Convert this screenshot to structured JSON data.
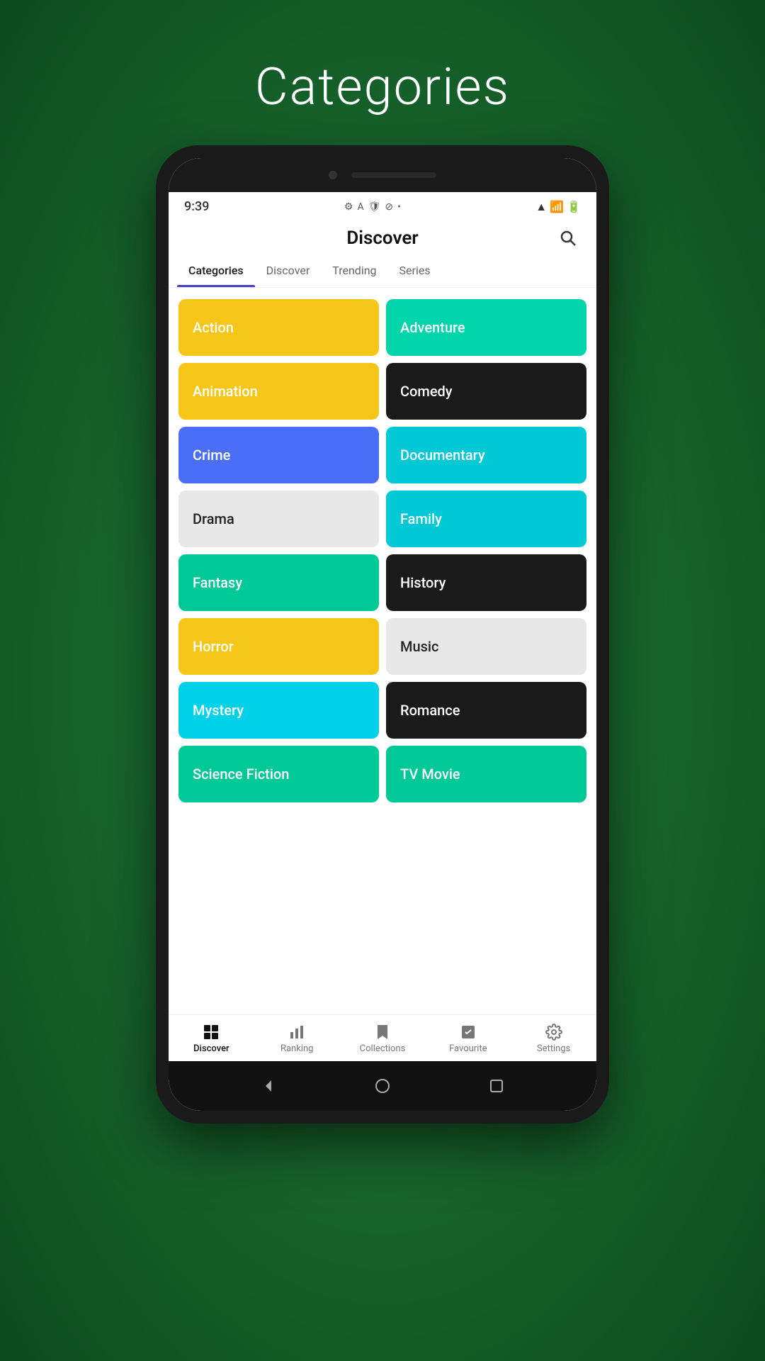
{
  "page": {
    "title": "Categories",
    "background_color": "#1a6b30"
  },
  "status_bar": {
    "time": "9:39",
    "dot": "•"
  },
  "app_header": {
    "title": "Discover"
  },
  "tabs": [
    {
      "label": "Categories",
      "active": true
    },
    {
      "label": "Discover",
      "active": false
    },
    {
      "label": "Trending",
      "active": false
    },
    {
      "label": "Series",
      "active": false
    }
  ],
  "categories": [
    {
      "label": "Action",
      "bg": "bg-yellow",
      "text": "light-text"
    },
    {
      "label": "Adventure",
      "bg": "bg-green",
      "text": "light-text"
    },
    {
      "label": "Animation",
      "bg": "bg-yellow",
      "text": "light-text"
    },
    {
      "label": "Comedy",
      "bg": "bg-dark",
      "text": "light-text"
    },
    {
      "label": "Crime",
      "bg": "bg-blue",
      "text": "light-text"
    },
    {
      "label": "Documentary",
      "bg": "bg-cyan",
      "text": "light-text"
    },
    {
      "label": "Drama",
      "bg": "bg-light",
      "text": "dark-text"
    },
    {
      "label": "Family",
      "bg": "bg-cyan",
      "text": "light-text"
    },
    {
      "label": "Fantasy",
      "bg": "bg-teal",
      "text": "light-text"
    },
    {
      "label": "History",
      "bg": "bg-dark",
      "text": "light-text"
    },
    {
      "label": "Horror",
      "bg": "bg-yellow",
      "text": "light-text"
    },
    {
      "label": "Music",
      "bg": "bg-light",
      "text": "dark-text"
    },
    {
      "label": "Mystery",
      "bg": "bg-cyan2",
      "text": "light-text"
    },
    {
      "label": "Romance",
      "bg": "bg-dark",
      "text": "light-text"
    },
    {
      "label": "Science Fiction",
      "bg": "bg-teal",
      "text": "light-text"
    },
    {
      "label": "TV Movie",
      "bg": "bg-teal",
      "text": "light-text"
    }
  ],
  "bottom_nav": [
    {
      "label": "Discover",
      "active": true,
      "icon": "🎬"
    },
    {
      "label": "Ranking",
      "active": false,
      "icon": "📊"
    },
    {
      "label": "Collections",
      "active": false,
      "icon": "🎞"
    },
    {
      "label": "Favourite",
      "active": false,
      "icon": "🔖"
    },
    {
      "label": "Settings",
      "active": false,
      "icon": "⚙"
    }
  ]
}
